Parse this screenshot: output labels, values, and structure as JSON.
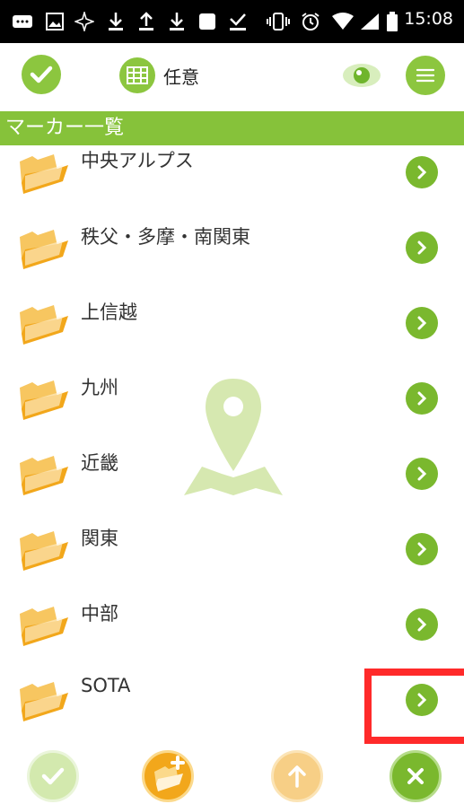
{
  "status_bar": {
    "time": "15:08",
    "icons": [
      "keyboard-icon",
      "image-icon",
      "brightness-icon",
      "download-icon",
      "upload-icon",
      "download-icon",
      "stop-icon",
      "check-download-icon",
      "vibrate-icon",
      "alarm-icon",
      "wifi-icon",
      "signal-icon",
      "battery-icon"
    ]
  },
  "toolbar": {
    "mode_label": "任意"
  },
  "section": {
    "title": "マーカー一覧"
  },
  "list": {
    "items": [
      {
        "label": "中央アルプス"
      },
      {
        "label": "秩父・多摩・南関東"
      },
      {
        "label": "上信越"
      },
      {
        "label": "九州"
      },
      {
        "label": "近畿"
      },
      {
        "label": "関東"
      },
      {
        "label": "中部"
      },
      {
        "label": "SOTA"
      }
    ]
  },
  "colors": {
    "accent": "#86c23a",
    "folder": "#f2a71b",
    "highlight": "#ff2a2a"
  }
}
